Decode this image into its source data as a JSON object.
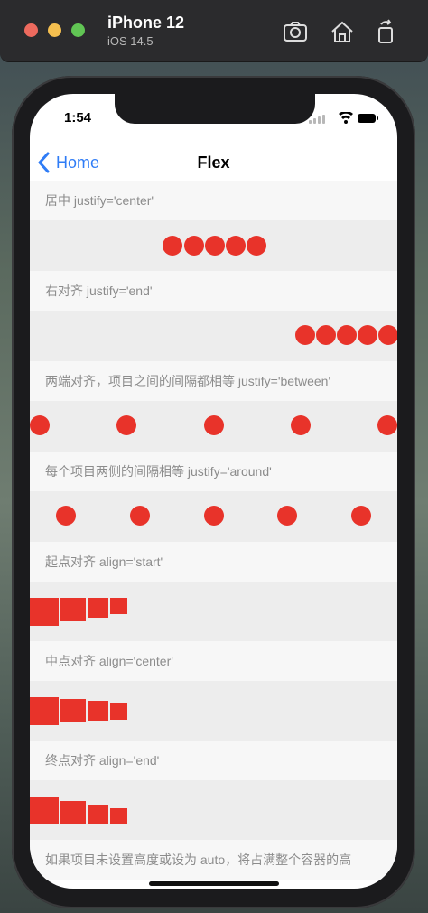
{
  "simulator": {
    "device": "iPhone 12",
    "os": "iOS 14.5",
    "icons": [
      "screenshot-icon",
      "home-icon",
      "rotate-icon"
    ]
  },
  "status_bar": {
    "time": "1:54"
  },
  "nav": {
    "back_label": "Home",
    "title": "Flex"
  },
  "sections": [
    {
      "label": "居中 justify='center'"
    },
    {
      "label": "右对齐 justify='end'"
    },
    {
      "label": "两端对齐，项目之间的间隔都相等 justify='between'"
    },
    {
      "label": "每个项目两侧的间隔相等 justify='around'"
    },
    {
      "label": "起点对齐 align='start'"
    },
    {
      "label": "中点对齐 align='center'"
    },
    {
      "label": "终点对齐 align='end'"
    },
    {
      "label": "如果项目未设置高度或设为 auto，将占满整个容器的高"
    }
  ],
  "colors": {
    "accent": "#2f7cf6",
    "item": "#e8332a",
    "row_bg": "#ededed",
    "label_bg": "#f7f7f7",
    "label_text": "#8c8c8c"
  }
}
